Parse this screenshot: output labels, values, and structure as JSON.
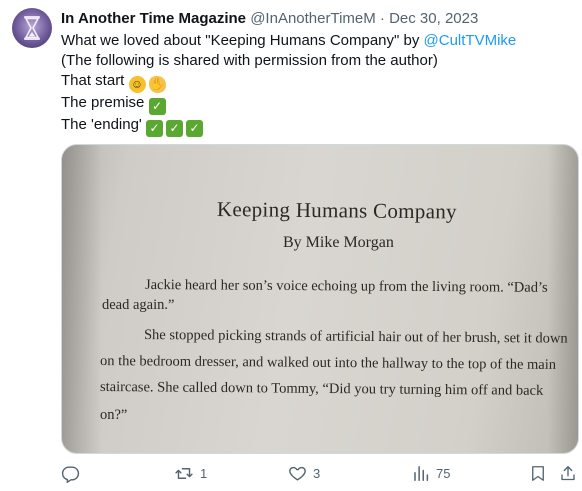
{
  "tweet": {
    "display_name": "In Another Time Magazine",
    "handle": "@InAnotherTimeM",
    "separator": "·",
    "date": "Dec 30, 2023",
    "text_prefix": "What we loved about \"Keeping Humans Company\" by ",
    "mention": "@CultTVMike",
    "line2": "(The following is shared with permission from the author)",
    "line3": "That start",
    "line4": "The premise",
    "line5": "The 'ending'"
  },
  "photo": {
    "book_title": "Keeping Humans Company",
    "book_author": "By Mike Morgan",
    "paragraph_lines": [
      "Jackie heard her son’s voice echoing up from the living room. “Dad’s",
      "dead again.”",
      "She stopped picking strands of artificial hair out of her brush, set it down",
      "on the bedroom dresser, and walked out into the hallway to the top of the main",
      "staircase. She called down to Tommy, “Did you try turning him off and back",
      "on?”"
    ]
  },
  "actions": {
    "reply_count": "",
    "retweet_count": "1",
    "like_count": "3",
    "views_count": "75"
  },
  "icons": {
    "reply": "reply-icon",
    "retweet": "retweet-icon",
    "like": "heart-icon",
    "views": "views-icon",
    "bookmark": "bookmark-icon",
    "share": "share-icon"
  },
  "colors": {
    "link": "#1d9bf0",
    "muted": "#536471",
    "check_emoji": "#5aa832"
  }
}
